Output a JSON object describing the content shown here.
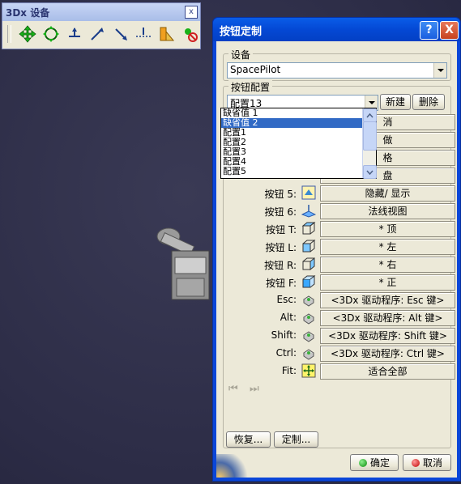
{
  "toolbar": {
    "title": "3Dx 设备",
    "close_label": "x",
    "icons": [
      "move-icon",
      "rotate-icon",
      "pan-icon",
      "zoom-icon",
      "zoom-out-icon",
      "align-icon",
      "ruler-icon",
      "disable-icon"
    ]
  },
  "dialog": {
    "title": "按钮定制",
    "help_label": "?",
    "close_label": "X",
    "device_group_label": "设备",
    "device_value": "SpacePilot",
    "config_group_label": "按钮配置",
    "config_value": "配置13",
    "new_button": "新建",
    "delete_button": "删除",
    "restore_button": "恢复...",
    "customize_button": "定制...",
    "ok_button": "确定",
    "cancel_button": "取消"
  },
  "dropdown": {
    "items": [
      "缺省值 1",
      "缺省值 2",
      "配置1",
      "配置2",
      "配置3",
      "配置4",
      "配置5"
    ],
    "selected_index": 1
  },
  "hidden_rows": [
    {
      "field": "消"
    },
    {
      "field": "做"
    },
    {
      "field": "格"
    },
    {
      "field": "盘"
    }
  ],
  "rows": [
    {
      "label": "按钮 5:",
      "field": "隐藏/ 显示",
      "icon": "hide-show-icon"
    },
    {
      "label": "按钮 6:",
      "field": "法线视图",
      "icon": "normal-view-icon"
    },
    {
      "label": "按钮 T:",
      "field": "* 顶",
      "icon": "cube-top-icon"
    },
    {
      "label": "按钮 L:",
      "field": "* 左",
      "icon": "cube-left-icon"
    },
    {
      "label": "按钮 R:",
      "field": "* 右",
      "icon": "cube-right-icon"
    },
    {
      "label": "按钮 F:",
      "field": "* 正",
      "icon": "cube-front-icon"
    },
    {
      "label": "Esc:",
      "field": "<3Dx 驱动程序: Esc 键>",
      "icon": "driver-icon"
    },
    {
      "label": "Alt:",
      "field": "<3Dx 驱动程序: Alt 键>",
      "icon": "driver-icon"
    },
    {
      "label": "Shift:",
      "field": "<3Dx 驱动程序: Shift 键>",
      "icon": "driver-icon"
    },
    {
      "label": "Ctrl:",
      "field": "<3Dx 驱动程序: Ctrl 键>",
      "icon": "driver-icon"
    },
    {
      "label": "Fit:",
      "field": "适合全部",
      "icon": "fit-all-icon"
    }
  ],
  "nav": {
    "first_label": "⏮",
    "prev_label": "⏭"
  }
}
